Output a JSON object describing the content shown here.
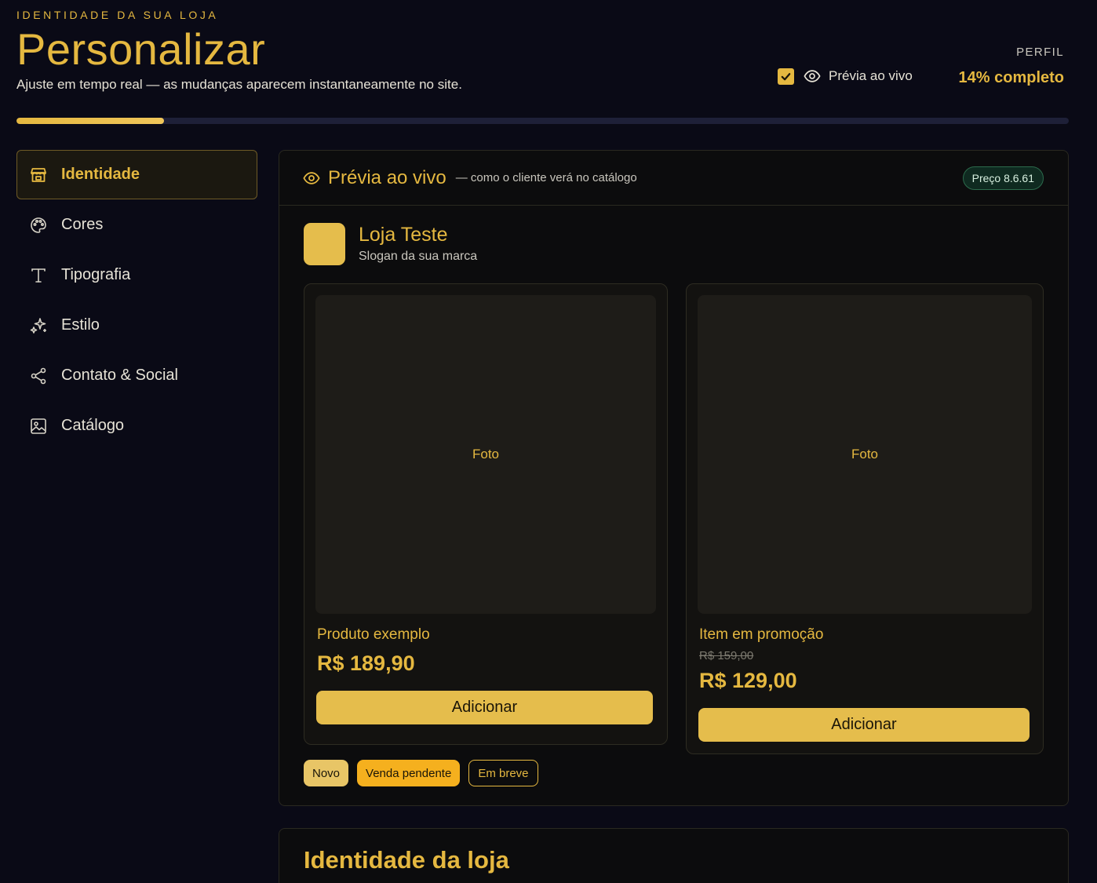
{
  "header": {
    "eyebrow": "IDENTIDADE DA SUA LOJA",
    "title": "Personalizar",
    "subtitle": "Ajuste em tempo real — as mudanças aparecem instantaneamente no site.",
    "profile_label": "PERFIL",
    "completion_text": "14% completo",
    "completion_value": 0.14,
    "live_preview_label": "Prévia ao vivo",
    "live_preview_checked": true
  },
  "sidebar": {
    "items": [
      {
        "label": "Identidade",
        "icon": "store-icon",
        "active": true
      },
      {
        "label": "Cores",
        "icon": "palette-icon",
        "active": false
      },
      {
        "label": "Tipografia",
        "icon": "type-icon",
        "active": false
      },
      {
        "label": "Estilo",
        "icon": "sparkles-icon",
        "active": false
      },
      {
        "label": "Contato & Social",
        "icon": "share-icon",
        "active": false
      },
      {
        "label": "Catálogo",
        "icon": "image-icon",
        "active": false
      }
    ]
  },
  "preview": {
    "title": "Prévia ao vivo",
    "subtitle": "— como o cliente verá no catálogo",
    "badge": "Preço 8.6.61",
    "store_name": "Loja Teste",
    "store_slogan": "Slogan da sua marca",
    "products": [
      {
        "photo_label": "Foto",
        "name": "Produto exemplo",
        "old_price": "",
        "price": "R$ 189,90",
        "button": "Adicionar"
      },
      {
        "photo_label": "Foto",
        "name": "Item em promoção",
        "old_price": "R$ 159,00",
        "price": "R$ 129,00",
        "button": "Adicionar"
      }
    ],
    "tags": [
      "Novo",
      "Venda pendente",
      "Em breve"
    ]
  },
  "identity_section": {
    "title": "Identidade da loja"
  },
  "colors": {
    "accent": "#e5b840",
    "background": "#0a0a16",
    "badge_green": "#0f2a20"
  }
}
